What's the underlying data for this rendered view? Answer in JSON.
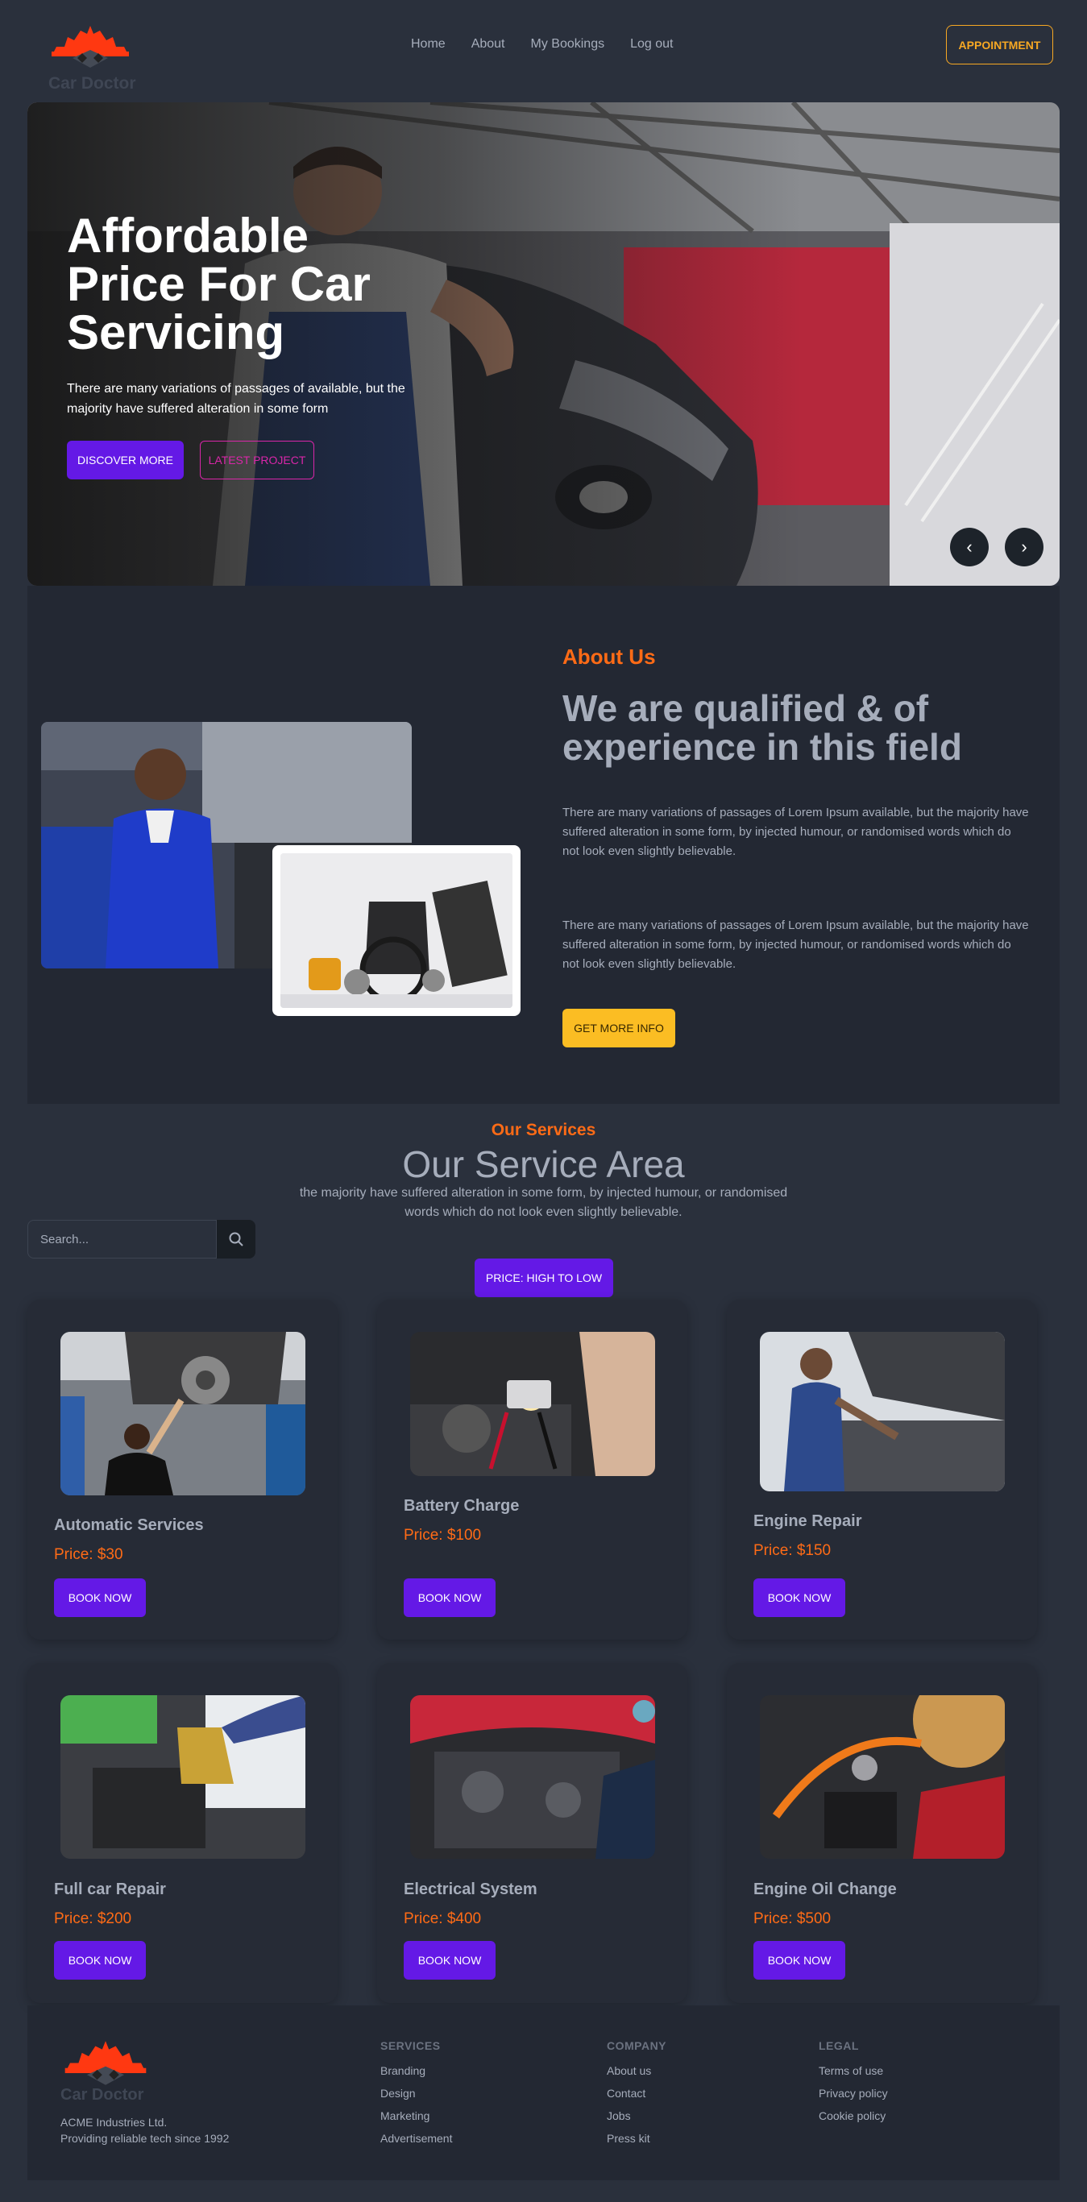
{
  "nav": {
    "brand": "Car Doctor",
    "links": [
      "Home",
      "About",
      "My Bookings",
      "Log out"
    ],
    "appointment": "APPOINTMENT"
  },
  "hero": {
    "title": "Affordable Price For Car Servicing",
    "text": "There are many variations of passages of available, but the majority have suffered alteration in some form",
    "discover": "DISCOVER MORE",
    "latest": "LATEST PROJECT",
    "prev": "‹",
    "next": "›"
  },
  "about": {
    "subtitle": "About Us",
    "title": "We are qualified & of experience in this field",
    "p1": "There are many variations of passages of Lorem Ipsum available, but the majority have suffered alteration in some form, by injected humour, or randomised words which do not look even slightly believable.",
    "p2": "There are many variations of passages of Lorem Ipsum available, but the majority have suffered alteration in some form, by injected humour, or randomised words which do not look even slightly believable.",
    "button": "GET MORE INFO"
  },
  "services": {
    "subtitle": "Our Services",
    "title": "Our Service Area",
    "desc": "the majority have suffered alteration in some form, by injected humour, or randomised words which do not look even slightly believable.",
    "search_placeholder": "Search...",
    "sort": "PRICE: HIGH TO LOW",
    "book": "BOOK NOW",
    "items": [
      {
        "name": "Automatic Services",
        "price": "Price: $30"
      },
      {
        "name": "Battery Charge",
        "price": "Price: $100"
      },
      {
        "name": "Engine Repair",
        "price": "Price: $150"
      },
      {
        "name": "Full car Repair",
        "price": "Price: $200"
      },
      {
        "name": "Electrical System",
        "price": "Price: $400"
      },
      {
        "name": "Engine Oil Change",
        "price": "Price: $500"
      }
    ]
  },
  "footer": {
    "brand": "Car Doctor",
    "company_line1": "ACME Industries Ltd.",
    "company_line2": "Providing reliable tech since 1992",
    "services": {
      "heading": "SERVICES",
      "links": [
        "Branding",
        "Design",
        "Marketing",
        "Advertisement"
      ]
    },
    "company": {
      "heading": "COMPANY",
      "links": [
        "About us",
        "Contact",
        "Jobs",
        "Press kit"
      ]
    },
    "legal": {
      "heading": "LEGAL",
      "links": [
        "Terms of use",
        "Privacy policy",
        "Cookie policy"
      ]
    }
  },
  "colors": {
    "background": "#2a303c",
    "primary": "#6419e6",
    "accent_orange": "#ff6b16",
    "warning": "#fbbd23",
    "secondary": "#d926a9"
  }
}
